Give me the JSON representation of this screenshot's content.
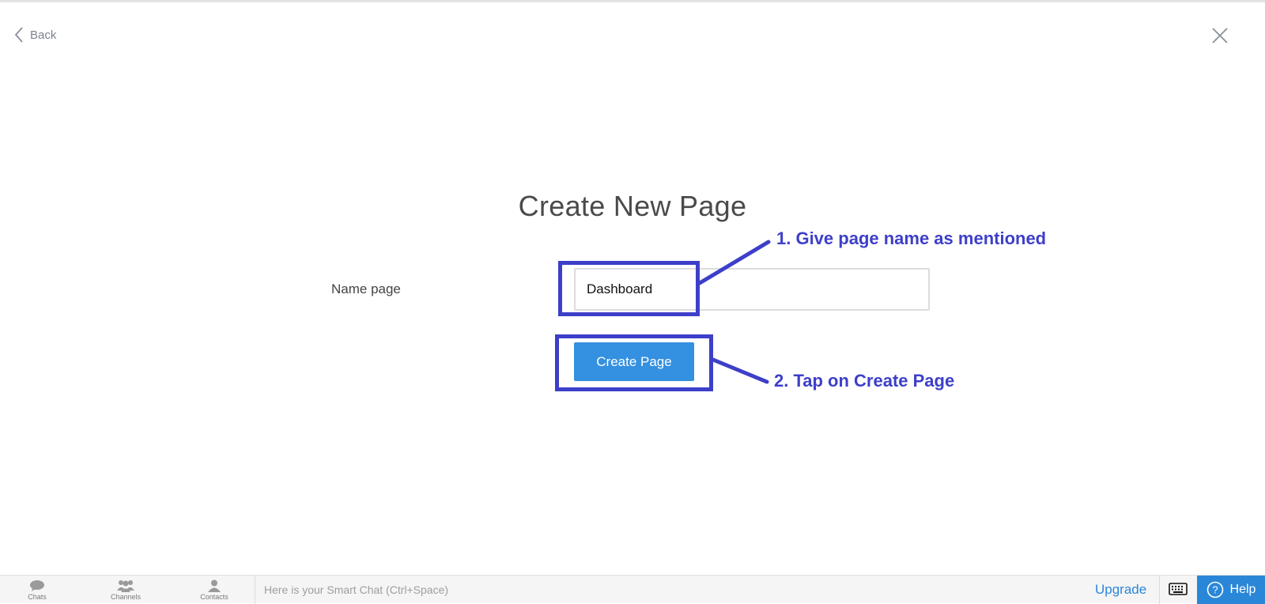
{
  "header": {
    "back_label": "Back",
    "close_icon": "close-icon",
    "back_icon": "chevron-left-icon"
  },
  "form": {
    "title": "Create New Page",
    "name_label": "Name page",
    "name_value": "Dashboard",
    "create_button_label": "Create Page"
  },
  "annotations": {
    "step1": "1. Give page name as mentioned",
    "step2": "2. Tap on Create Page",
    "color": "#3d3fc9"
  },
  "bottom_bar": {
    "nav": [
      {
        "label": "Chats",
        "icon": "chat-bubble-icon"
      },
      {
        "label": "Channels",
        "icon": "group-icon"
      },
      {
        "label": "Contacts",
        "icon": "person-icon"
      }
    ],
    "smart_chat_placeholder": "Here is your Smart Chat (Ctrl+Space)",
    "upgrade_label": "Upgrade",
    "keyboard_icon": "keyboard-icon",
    "help_label": "Help",
    "help_icon": "question-circle-icon"
  },
  "colors": {
    "accent": "#3490e0",
    "link": "#2a87d8",
    "annotation": "#3d3fc9"
  }
}
